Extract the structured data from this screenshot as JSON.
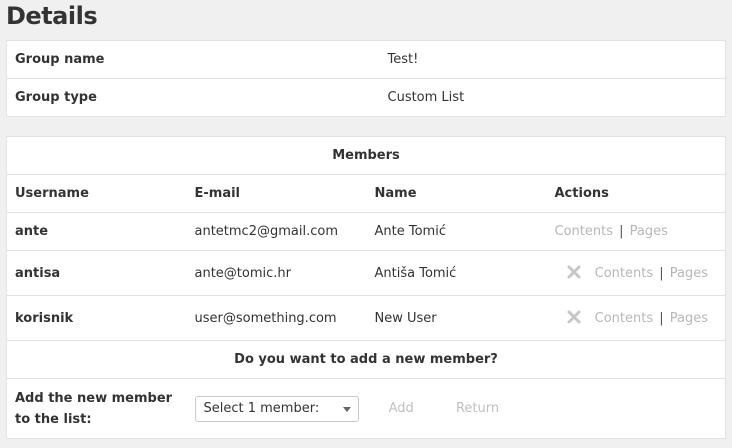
{
  "page": {
    "title": "Details"
  },
  "details": {
    "rows": [
      {
        "label": "Group name",
        "value": "Test!"
      },
      {
        "label": "Group type",
        "value": "Custom List"
      }
    ]
  },
  "members": {
    "title": "Members",
    "columns": {
      "username": "Username",
      "email": "E-mail",
      "name": "Name",
      "actions": "Actions"
    },
    "rows": [
      {
        "username": "ante",
        "email": "antetmc2@gmail.com",
        "name": "Ante Tomić",
        "contents": "Contents",
        "separator": "|",
        "pages": "Pages"
      },
      {
        "username": "antisa",
        "email": "ante@tomic.hr",
        "name": "Antiša Tomić",
        "contents": "Contents",
        "separator": "|",
        "pages": "Pages"
      },
      {
        "username": "korisnik",
        "email": "user@something.com",
        "name": "New User",
        "contents": "Contents",
        "separator": "|",
        "pages": "Pages"
      }
    ]
  },
  "add_member": {
    "question": "Do you want to add a new member?",
    "label": "Add the new member to the list:",
    "select_value": "Select 1 member:",
    "add_label": "Add",
    "return_label": "Return"
  },
  "colors": {
    "muted_link": "#b7b7b7",
    "border": "#e2e2e2",
    "delete_icon": "#c6c6c6"
  }
}
